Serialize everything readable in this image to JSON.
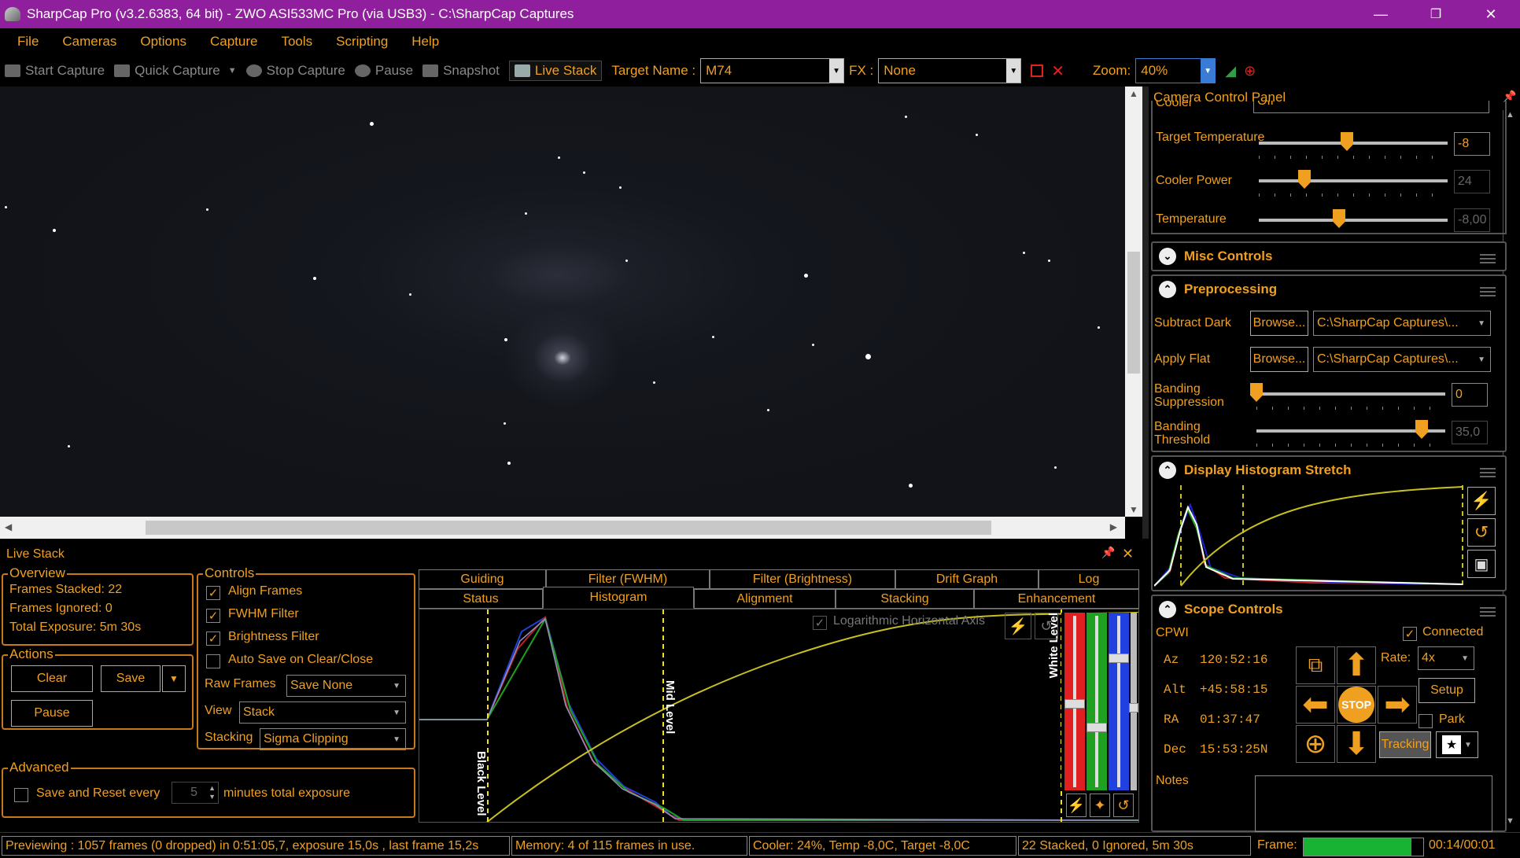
{
  "titlebar": {
    "title": "SharpCap Pro (v3.2.6383, 64 bit) - ZWO ASI533MC Pro (via USB3) - C:\\SharpCap Captures",
    "minimize": "—",
    "maximize": "❐",
    "close": "✕"
  },
  "menu": [
    "File",
    "Cameras",
    "Options",
    "Capture",
    "Tools",
    "Scripting",
    "Help"
  ],
  "toolbar": {
    "start_capture": "Start Capture",
    "quick_capture": "Quick Capture",
    "stop_capture": "Stop Capture",
    "pause": "Pause",
    "snapshot": "Snapshot",
    "live_stack": "Live Stack",
    "target_name_label": "Target Name :",
    "target_name": "M74",
    "fx_label": "FX :",
    "fx_value": "None",
    "zoom_label": "Zoom:",
    "zoom_value": "40%"
  },
  "camera_panel": {
    "title": "Camera Control Panel",
    "cooler_label": "Cooler",
    "cooler_value": "Off",
    "target_temp_label": "Target Temperature",
    "target_temp_value": "-8",
    "cooler_power_label": "Cooler Power",
    "cooler_power_value": "24",
    "temperature_label": "Temperature",
    "temperature_value": "-8,00",
    "misc_controls": "Misc Controls",
    "preprocessing": "Preprocessing",
    "subtract_dark_label": "Subtract Dark",
    "apply_flat_label": "Apply Flat",
    "browse": "Browse...",
    "dark_path": "C:\\SharpCap Captures\\...",
    "flat_path": "C:\\SharpCap Captures\\...",
    "banding_suppression_label": "Banding Suppression",
    "banding_suppression_value": "0",
    "banding_threshold_label": "Banding Threshold",
    "banding_threshold_value": "35,0",
    "display_histogram_stretch": "Display Histogram Stretch",
    "scope_controls": "Scope Controls",
    "scope_name": "CPWI",
    "connected_label": "Connected",
    "az_label": "Az",
    "az_value": "120:52:16",
    "alt_label": "Alt",
    "alt_value": "+45:58:15",
    "ra_label": "RA",
    "ra_value": "01:37:47",
    "dec_label": "Dec",
    "dec_value": "15:53:25N",
    "rate_label": "Rate:",
    "rate_value": "4x",
    "setup": "Setup",
    "park": "Park",
    "stop": "STOP",
    "tracking": "Tracking",
    "notes_label": "Notes"
  },
  "live_stack": {
    "title": "Live Stack",
    "overview_title": "Overview",
    "frames_stacked": "Frames Stacked: 22",
    "frames_ignored": "Frames Ignored:  0",
    "total_exposure": "Total Exposure:    5m 30s",
    "actions_title": "Actions",
    "clear": "Clear",
    "save": "Save",
    "pause": "Pause",
    "controls_title": "Controls",
    "align_frames": "Align Frames",
    "fwhm_filter": "FWHM Filter",
    "brightness_filter": "Brightness Filter",
    "auto_save": "Auto Save on Clear/Close",
    "raw_frames_label": "Raw Frames",
    "raw_frames_value": "Save None",
    "view_label": "View",
    "view_value": "Stack",
    "stacking_label": "Stacking",
    "stacking_value": "Sigma Clipping",
    "advanced_title": "Advanced",
    "save_reset_label": "Save and Reset every",
    "save_reset_value": "5",
    "minutes_label": "minutes total exposure",
    "tabs_row1": [
      "Guiding",
      "Filter (FWHM)",
      "Filter (Brightness)",
      "Drift Graph",
      "Log"
    ],
    "tabs_row2": [
      "Status",
      "Histogram",
      "Alignment",
      "Stacking",
      "Enhancement"
    ],
    "log_axis_label": "Logarithmic Horizontal Axis",
    "black_level": "Black Level",
    "mid_level": "Mid Level",
    "white_level": "White Level"
  },
  "status": {
    "preview": "Previewing : 1057 frames (0 dropped) in 0:51:05,7, exposure 15,0s , last frame 15,2s",
    "memory": "Memory: 4 of 115 frames in use.",
    "cooler": "Cooler: 24%, Temp -8,0C, Target -8,0C",
    "stacked": "22 Stacked, 0 Ignored, 5m 30s",
    "frame_label": "Frame:",
    "frame_time": "00:14/00:01",
    "frame_progress": 0.9
  },
  "colors": {
    "accent": "#f0a020",
    "titlebar": "#8f1f9c",
    "frame_bar": "#19b334"
  }
}
